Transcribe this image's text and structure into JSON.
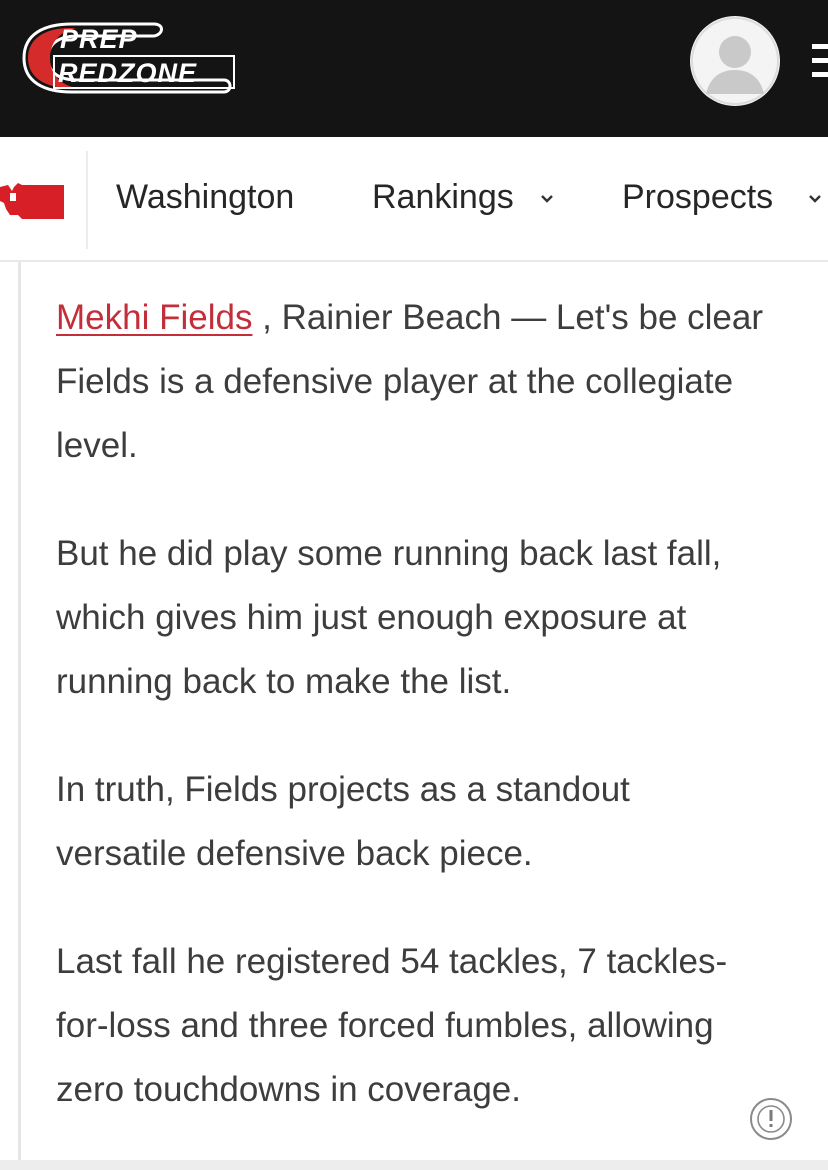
{
  "header": {
    "logo_line1": "PREP",
    "logo_line2": "REDZONE",
    "brand_color": "#d52b2b",
    "background": "#141414",
    "avatar_icon": "user-avatar-icon",
    "menu_icon": "hamburger-menu-icon"
  },
  "nav": {
    "state_icon": "washington-state-icon",
    "items": [
      {
        "label": "Washington",
        "has_dropdown": false
      },
      {
        "label": "Rankings",
        "has_dropdown": true
      },
      {
        "label": "Prospects",
        "has_dropdown": true
      }
    ]
  },
  "article": {
    "link_color": "#c22e3a",
    "paragraphs": [
      {
        "player_link": "Mekhi Fields",
        "lines": [
          " , Rainier Beach — Let's be clear",
          "Fields is a defensive player at the collegiate",
          "level."
        ]
      },
      {
        "lines": [
          "But he did play some running back last fall,",
          "which gives him just enough exposure at",
          "running back to make the list."
        ]
      },
      {
        "lines": [
          "In truth, Fields projects as a standout",
          "versatile defensive back piece."
        ]
      },
      {
        "lines": [
          "Last fall he registered 54 tackles, 7 tackles-",
          "for-loss and three forced fumbles, allowing",
          "zero touchdowns in coverage."
        ]
      }
    ]
  },
  "overlay": {
    "alert_icon": "exclamation-circle-icon"
  }
}
